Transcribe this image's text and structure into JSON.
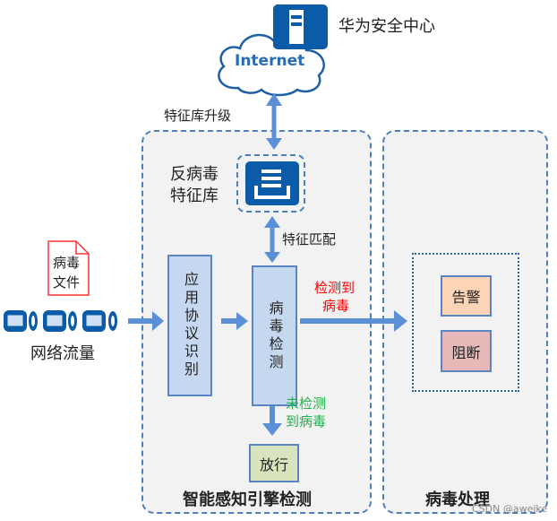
{
  "cloud": {
    "label": "Internet",
    "server_label": "华为安全中心"
  },
  "upgrade_label": "特征库升级",
  "engine": {
    "title": "智能感知引擎检测",
    "signature_db_label_line1": "反病毒",
    "signature_db_label_line2": "特征库",
    "match_label": "特征匹配",
    "protocol_box": "应用协议识别",
    "detect_box": "病毒检测",
    "detected_line1": "检测到",
    "detected_line2": "病毒",
    "not_detected_line1": "未检测",
    "not_detected_line2": "到病毒",
    "allow_box": "放行"
  },
  "disposal": {
    "title": "病毒处理",
    "alert": "告警",
    "block": "阻断"
  },
  "input": {
    "file_line1": "病毒",
    "file_line2": "文件",
    "traffic_label": "网络流量"
  },
  "watermark": "CSDN @aweike",
  "colors": {
    "accent": "#0b5ca8",
    "arrow": "#5b8fd6",
    "detected": "#ff0000",
    "not_detected": "#22b14c"
  }
}
